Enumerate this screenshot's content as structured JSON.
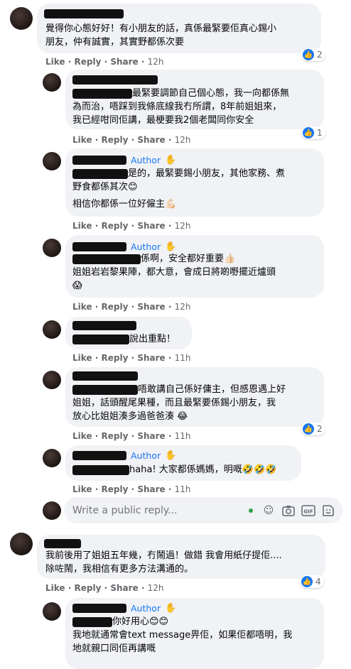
{
  "comments": [
    {
      "id": "c1",
      "text_lines": [
        "覺得你心態好好！有小朋友的話，真係最緊要佢真心錫小",
        "朋友，仲有誠實，其實野都係次要"
      ],
      "actions": {
        "like": "Like",
        "reply": "Reply",
        "share": "Share",
        "time": "12h"
      },
      "reactions": "2"
    },
    {
      "id": "r1",
      "text_lines": [
        "最緊要調節自己個心態，我一向都係無",
        "為而治，唔踩到我條底線我冇所謂，8年前姐姐來，",
        "我已經咁同佢講，最梗要我2個老闆同你安全"
      ],
      "actions": {
        "like": "Like",
        "reply": "Reply",
        "share": "Share",
        "time": "12h"
      },
      "reactions": "1"
    },
    {
      "id": "r2",
      "author_label": "Author",
      "text_lines": [
        "是的，最緊要錫小朋友，其他家務、煮",
        "野食都係其次😊"
      ],
      "extra_line": "相信你都係一位好僱主💪🏻",
      "actions": {
        "like": "Like",
        "reply": "Reply",
        "share": "Share",
        "time": "12h"
      }
    },
    {
      "id": "r3",
      "author_label": "Author",
      "text_lines": [
        "係啊，安全都好重要👍🏻",
        "姐姐岩岩黎果陣，都大意，會成日將啲嘢擺近爐頭",
        "😱"
      ],
      "actions": {
        "like": "Like",
        "reply": "Reply",
        "share": "Share",
        "time": "12h"
      }
    },
    {
      "id": "r4",
      "text_lines": [
        "說出重點！"
      ],
      "actions": {
        "like": "Like",
        "reply": "Reply",
        "share": "Share",
        "time": "11h"
      }
    },
    {
      "id": "r5",
      "text_lines": [
        "唔敢講自己係好傭主，但感恩遇上好",
        "姐姐，話頭醒尾果種，而且最緊要係錫小朋友，我",
        "放心比姐姐湊多過爸爸湊 😂"
      ],
      "actions": {
        "like": "Like",
        "reply": "Reply",
        "share": "Share",
        "time": "11h"
      },
      "reactions": "2"
    },
    {
      "id": "r6",
      "author_label": "Author",
      "text_lines": [
        "haha! 大家都係媽媽，明嘅🤣🤣🤣"
      ],
      "actions": {
        "like": "Like",
        "reply": "Reply",
        "share": "Share",
        "time": "11h"
      }
    },
    {
      "id": "c2",
      "text_lines": [
        "我前後用了姐姐五年幾，冇鬧過！做錯 我會用紙仔提佢....",
        "除咗鬧，我相信有更多方法溝通的。"
      ],
      "actions": {
        "like": "Like",
        "reply": "Reply",
        "share": "Share",
        "time": "12h"
      },
      "reactions": "4"
    },
    {
      "id": "r7",
      "author_label": "Author",
      "text_lines": [
        "你好用心😊😊",
        "我地就通常會text message畀佢，如果佢都唔明，我",
        "地就親口同佢再講嘅"
      ],
      "actions": {
        "like": "Like",
        "reply": "Reply",
        "share": "Share",
        "time": "12h"
      }
    }
  ],
  "reply_box": {
    "placeholder": "Write a public reply..."
  },
  "icons": {
    "like": "like-icon",
    "wave": "wave-hand-icon",
    "emoji": "emoji-icon",
    "camera": "camera-icon",
    "gif": "gif-icon",
    "sticker": "sticker-icon"
  },
  "colors": {
    "accent": "#1877f2",
    "bubble": "#f0f2f5",
    "meta": "#65676b"
  }
}
